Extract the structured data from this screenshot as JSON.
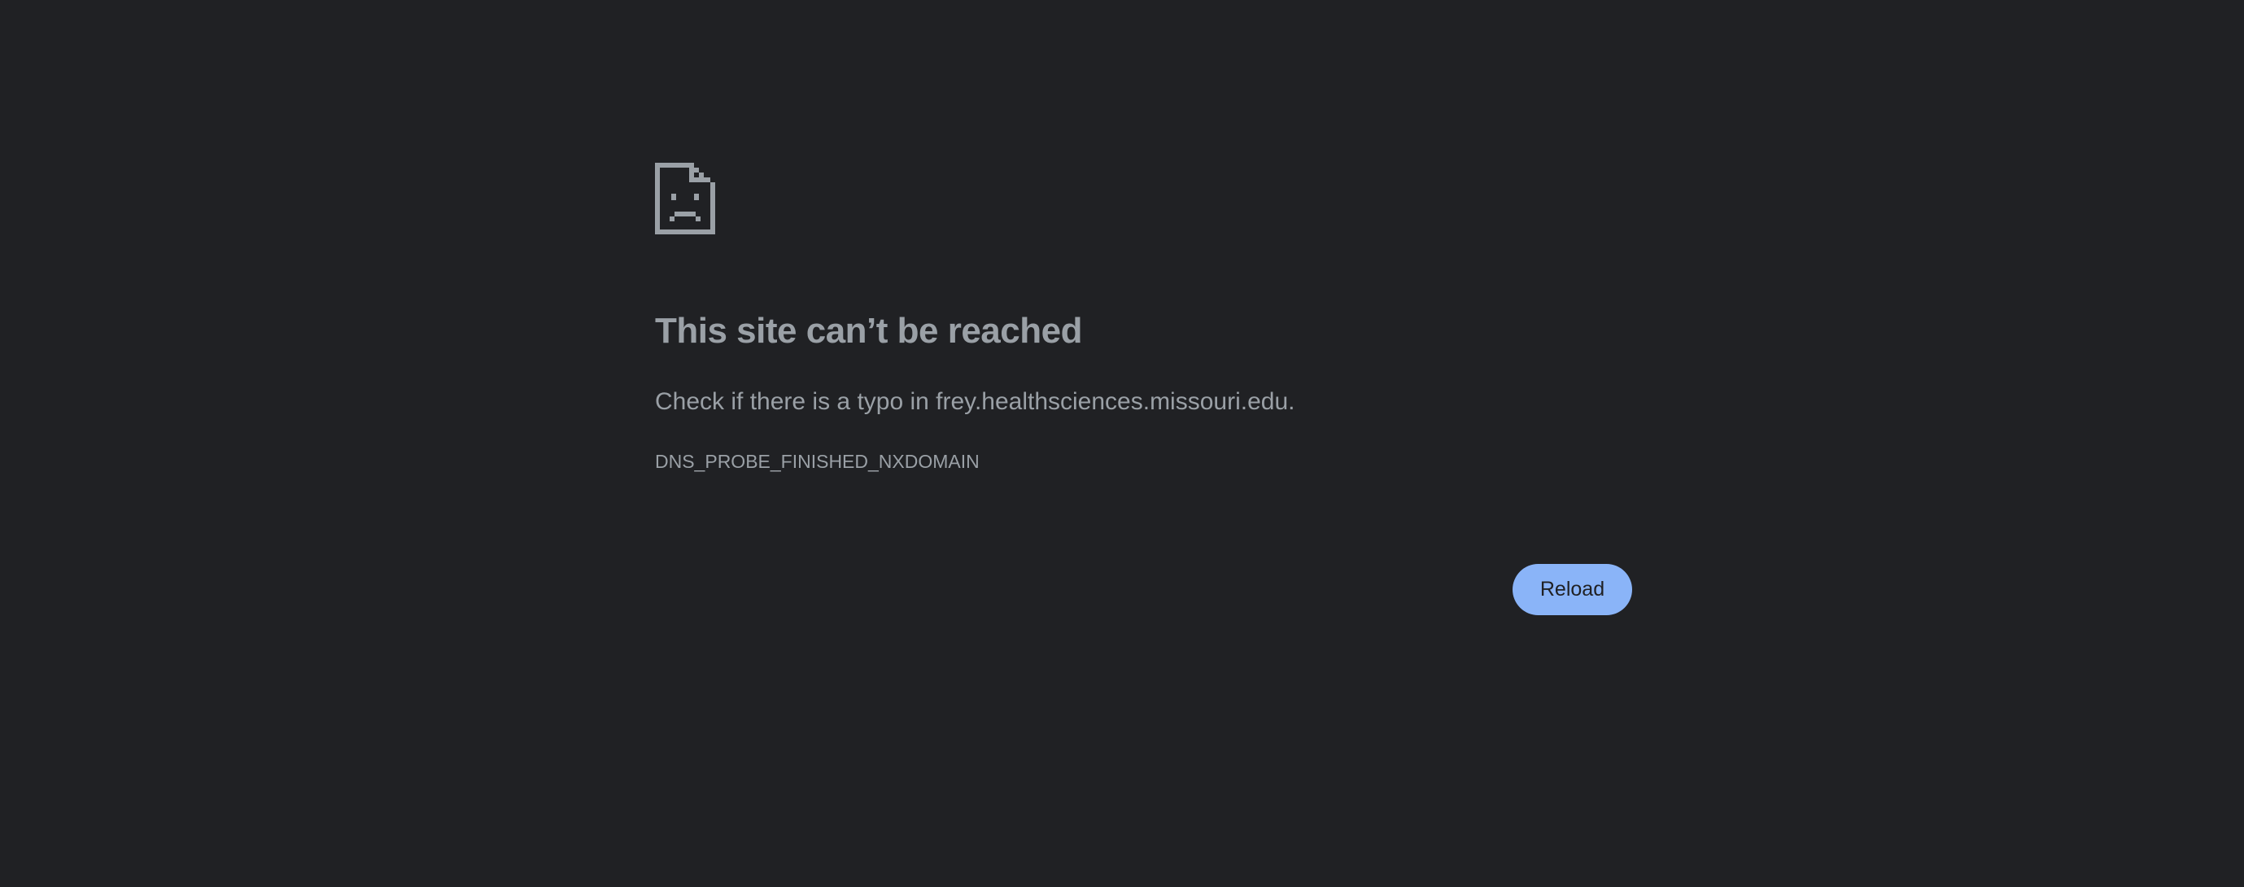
{
  "error_page": {
    "icon": "sad-document-icon",
    "heading": "This site can’t be reached",
    "suggestion": "Check if there is a typo in frey.healthsciences.missouri.edu.",
    "error_code": "DNS_PROBE_FINISHED_NXDOMAIN",
    "reload_label": "Reload"
  },
  "colors": {
    "background": "#202124",
    "text": "#9aa0a6",
    "button": "#8ab4f8",
    "button_text": "#202124"
  }
}
